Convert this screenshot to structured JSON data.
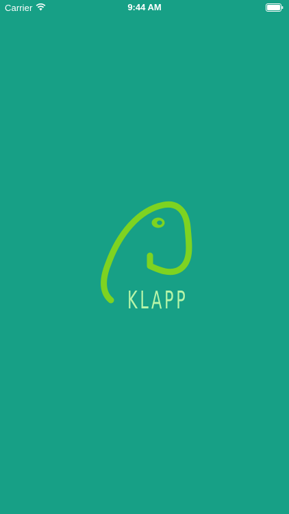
{
  "status_bar": {
    "carrier": "Carrier",
    "time": "9:44 AM",
    "wifi_icon": "wifi-icon",
    "battery_icon": "battery-icon"
  },
  "splash": {
    "logo_icon": "elephant-logo-icon",
    "app_name": "KLAPP"
  },
  "colors": {
    "background": "#17a086",
    "logo_green": "#7ed321",
    "logo_text": "#b6f5a9"
  }
}
